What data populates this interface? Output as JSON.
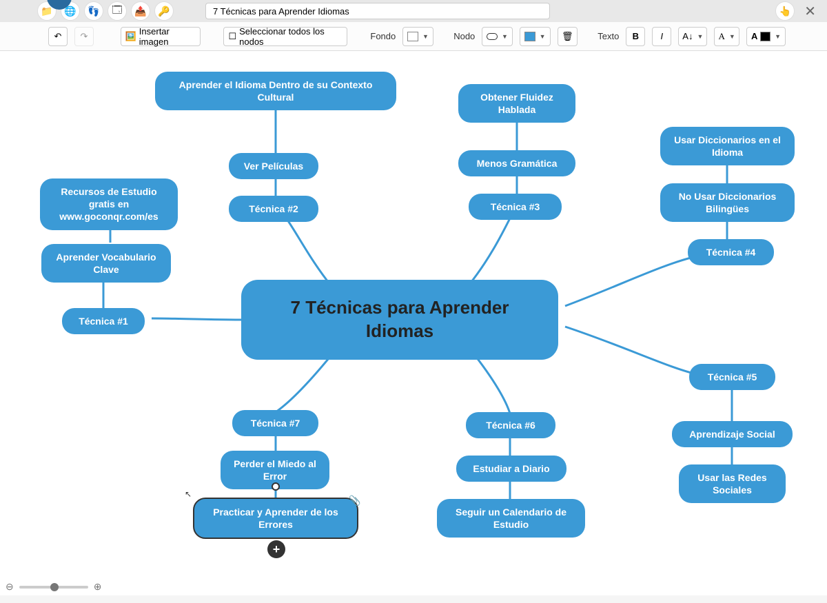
{
  "title": "7 Técnicas para Aprender Idiomas",
  "toolbar": {
    "insert_image": "Insertar imagen",
    "select_all": "Seleccionar todos los nodos",
    "fondo_label": "Fondo",
    "nodo_label": "Nodo",
    "texto_label": "Texto",
    "bold": "B",
    "italic": "I",
    "font_a1": "A↓",
    "font_a2": "A",
    "font_a3": "A"
  },
  "mindmap": {
    "center": "7 Técnicas para Aprender Idiomas",
    "t1": {
      "label": "Técnica #1",
      "c1": "Aprender Vocabulario Clave",
      "c2": "Recursos de Estudio gratis en www.goconqr.com/es"
    },
    "t2": {
      "label": "Técnica #2",
      "c1": "Ver Películas",
      "c2": "Aprender el Idioma Dentro de su Contexto Cultural"
    },
    "t3": {
      "label": "Técnica #3",
      "c1": "Menos Gramática",
      "c2": "Obtener Fluidez Hablada"
    },
    "t4": {
      "label": "Técnica #4",
      "c1": "No Usar Diccionarios Bilingües",
      "c2": "Usar Diccionarios en el Idioma"
    },
    "t5": {
      "label": "Técnica #5",
      "c1": "Aprendizaje Social",
      "c2": "Usar las Redes Sociales"
    },
    "t6": {
      "label": "Técnica #6",
      "c1": "Estudiar a Diario",
      "c2": "Seguir un Calendario de Estudio"
    },
    "t7": {
      "label": "Técnica #7",
      "c1": "Perder el Miedo al Error",
      "c2": "Practicar y Aprender de los Errores"
    }
  },
  "colors": {
    "node_fill": "#3b9ad6",
    "connector": "#3b9ad6"
  }
}
